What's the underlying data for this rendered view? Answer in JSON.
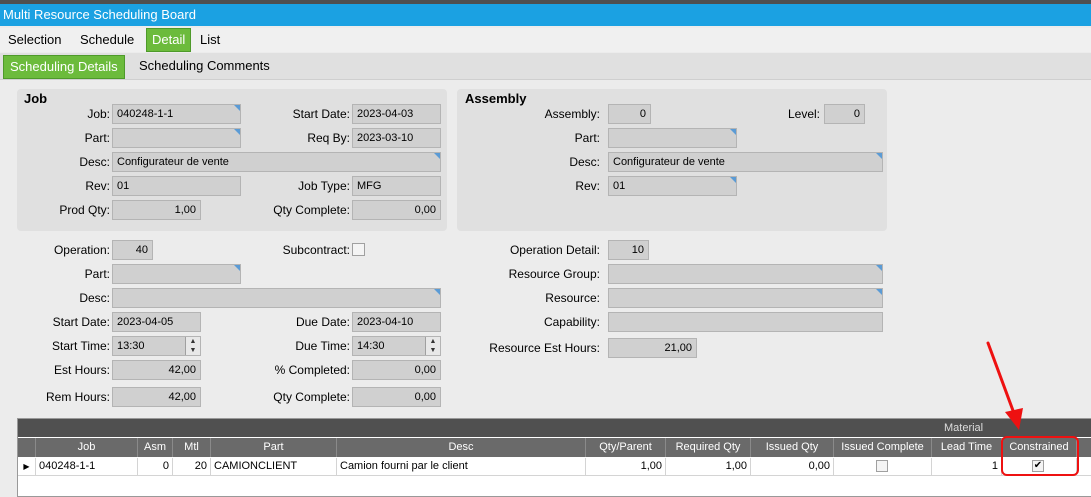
{
  "window": {
    "title": "Multi Resource Scheduling Board"
  },
  "main_tabs": [
    {
      "label": "Selection",
      "active": false
    },
    {
      "label": "Schedule",
      "active": false
    },
    {
      "label": "Detail",
      "active": true
    },
    {
      "label": "List",
      "active": false
    }
  ],
  "sub_tabs": [
    {
      "label": "Scheduling Details",
      "active": true
    },
    {
      "label": "Scheduling Comments",
      "active": false
    }
  ],
  "job": {
    "title": "Job",
    "job_label": "Job:",
    "job_value": "040248-1-1",
    "part_label": "Part:",
    "part_value": "",
    "desc_label": "Desc:",
    "desc_value": "Configurateur de vente",
    "rev_label": "Rev:",
    "rev_value": "01",
    "prodqty_label": "Prod Qty:",
    "prodqty_value": "1,00",
    "startdate_label": "Start Date:",
    "startdate_value": "2023-04-03",
    "reqby_label": "Req By:",
    "reqby_value": "2023-03-10",
    "jobtype_label": "Job Type:",
    "jobtype_value": "MFG",
    "qtycomplete_label": "Qty Complete:",
    "qtycomplete_value": "0,00"
  },
  "assembly": {
    "title": "Assembly",
    "assembly_label": "Assembly:",
    "assembly_value": "0",
    "level_label": "Level:",
    "level_value": "0",
    "part_label": "Part:",
    "part_value": "",
    "desc_label": "Desc:",
    "desc_value": "Configurateur de vente",
    "rev_label": "Rev:",
    "rev_value": "01"
  },
  "operation": {
    "operation_label": "Operation:",
    "operation_value": "40",
    "subcontract_label": "Subcontract:",
    "subcontract_checked": false,
    "part_label": "Part:",
    "part_value": "",
    "desc_label": "Desc:",
    "desc_value": "",
    "startdate_label": "Start Date:",
    "startdate_value": "2023-04-05",
    "duedate_label": "Due Date:",
    "duedate_value": "2023-04-10",
    "starttime_label": "Start Time:",
    "starttime_value": "13:30",
    "duetime_label": "Due Time:",
    "duetime_value": "14:30",
    "esthours_label": "Est Hours:",
    "esthours_value": "42,00",
    "pctcomplete_label": "% Completed:",
    "pctcomplete_value": "0,00",
    "remhours_label": "Rem Hours:",
    "remhours_value": "42,00",
    "qtycomplete_label": "Qty Complete:",
    "qtycomplete_value": "0,00",
    "opdetail_label": "Operation Detail:",
    "opdetail_value": "10",
    "resgroup_label": "Resource Group:",
    "resgroup_value": "",
    "resource_label": "Resource:",
    "resource_value": "",
    "capability_label": "Capability:",
    "capability_value": "",
    "resesthours_label": "Resource Est Hours:",
    "resesthours_value": "21,00"
  },
  "material_grid": {
    "band_label": "Material",
    "columns": [
      "Job",
      "Asm",
      "Mtl",
      "Part",
      "Desc",
      "Qty/Parent",
      "Required Qty",
      "Issued Qty",
      "Issued Complete",
      "Lead Time",
      "Constrained"
    ],
    "rows": [
      {
        "job": "040248-1-1",
        "asm": "0",
        "mtl": "20",
        "part": "CAMIONCLIENT",
        "desc": "Camion fourni par le client",
        "qty_parent": "1,00",
        "required_qty": "1,00",
        "issued_qty": "0,00",
        "issued_complete": false,
        "lead_time": "1",
        "constrained": true
      }
    ]
  },
  "colors": {
    "title_bar": "#1ba1e2",
    "active_tab": "#6cbb3c",
    "highlight": "#e11111"
  }
}
